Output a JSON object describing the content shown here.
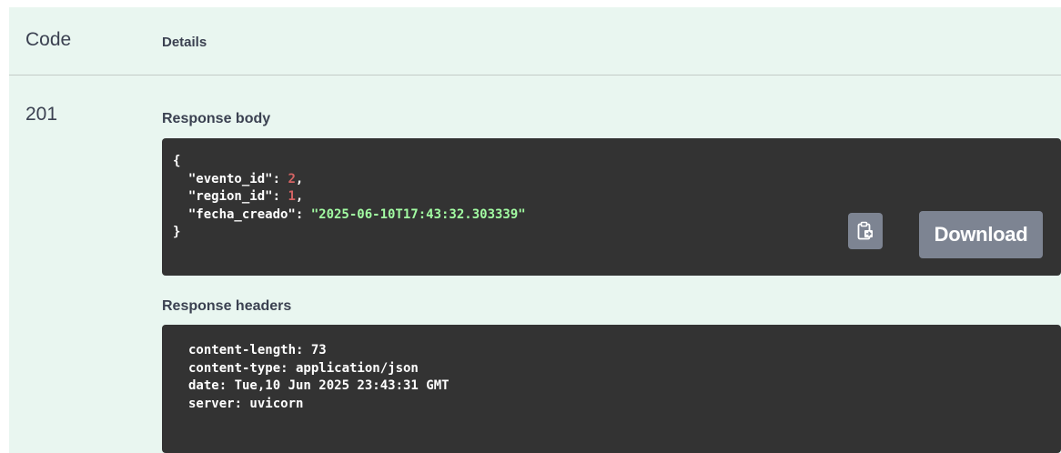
{
  "table": {
    "code_header": "Code",
    "details_header": "Details"
  },
  "response": {
    "code": "201",
    "body_label": "Response body",
    "body": {
      "open_brace": "{",
      "close_brace": "}",
      "fields": [
        {
          "key": "\"evento_id\": ",
          "value": "2",
          "type": "number",
          "suffix": ","
        },
        {
          "key": "\"region_id\": ",
          "value": "1",
          "type": "number",
          "suffix": ","
        },
        {
          "key": "\"fecha_creado\": ",
          "value": "\"2025-06-10T17:43:32.303339\"",
          "type": "string",
          "suffix": ""
        }
      ]
    },
    "copy_icon": "clipboard-copy-icon",
    "download_label": "Download",
    "headers_label": "Response headers",
    "headers": [
      "content-length: 73",
      "content-type: application/json",
      "date: Tue,10 Jun 2025 23:43:31 GMT",
      "server: uvicorn"
    ]
  },
  "colors": {
    "panel_bg": "#e9f6f0",
    "code_bg": "#333333",
    "number": "#d36363",
    "string": "#a2fca2",
    "button_bg": "#7d8492"
  }
}
